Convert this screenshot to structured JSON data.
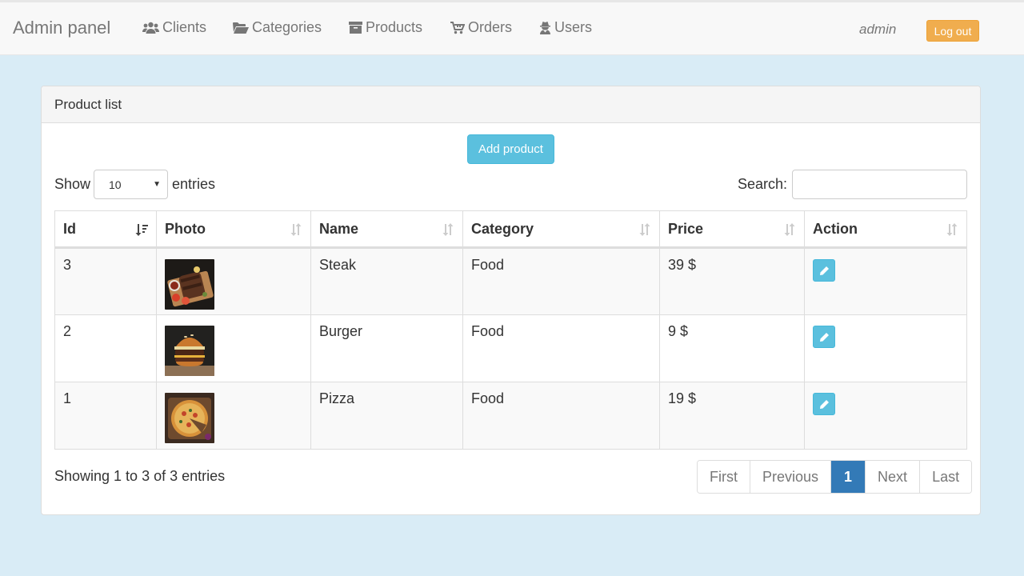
{
  "navbar": {
    "brand": "Admin panel",
    "items": [
      {
        "label": "Clients",
        "icon": "users-icon"
      },
      {
        "label": "Categories",
        "icon": "folder-open-icon"
      },
      {
        "label": "Products",
        "icon": "archive-icon"
      },
      {
        "label": "Orders",
        "icon": "cart-icon"
      },
      {
        "label": "Users",
        "icon": "user-secret-icon"
      }
    ],
    "user": "admin",
    "logout_label": "Log out"
  },
  "panel": {
    "title": "Product list",
    "add_label": "Add product"
  },
  "table_controls": {
    "show_label": "Show",
    "entries_value": "10",
    "entries_label": "entries",
    "search_label": "Search:",
    "search_value": ""
  },
  "table": {
    "columns": [
      "Id",
      "Photo",
      "Name",
      "Category",
      "Price",
      "Action"
    ],
    "rows": [
      {
        "id": "3",
        "photo": "steak-photo",
        "name": "Steak",
        "category": "Food",
        "price": "39 $"
      },
      {
        "id": "2",
        "photo": "burger-photo",
        "name": "Burger",
        "category": "Food",
        "price": "9 $"
      },
      {
        "id": "1",
        "photo": "pizza-photo",
        "name": "Pizza",
        "category": "Food",
        "price": "19 $"
      }
    ]
  },
  "footer": {
    "info": "Showing 1 to 3 of 3 entries",
    "pagination": [
      "First",
      "Previous",
      "1",
      "Next",
      "Last"
    ],
    "current_page": "1"
  },
  "colors": {
    "accent": "#5bc0de",
    "warning": "#f0ad4e",
    "primary": "#337ab7",
    "background": "#d9ecf6"
  }
}
